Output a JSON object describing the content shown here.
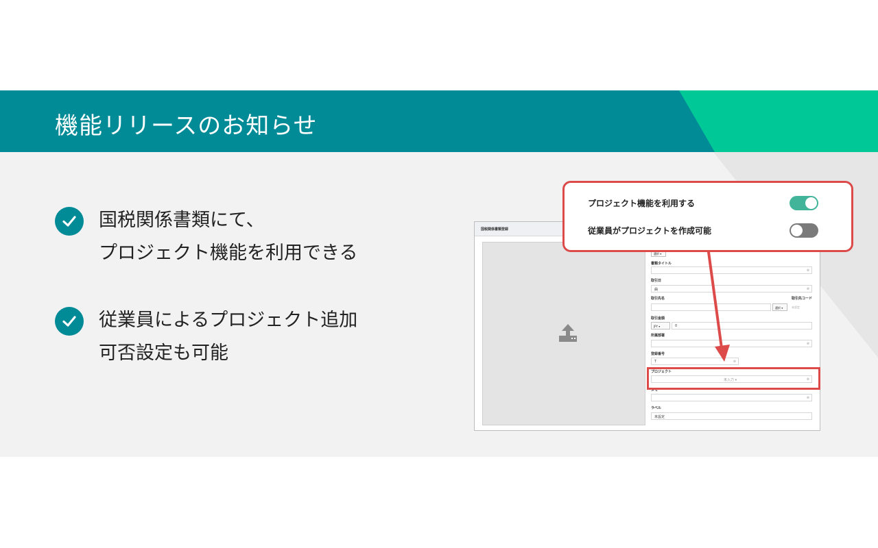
{
  "banner": {
    "title": "機能リリースのお知らせ"
  },
  "bullets": [
    {
      "line1": "国税関係書類にて、",
      "line2": "プロジェクト機能を利用できる"
    },
    {
      "line1": "従業員によるプロジェクト追加",
      "line2": "可否設定も可能"
    }
  ],
  "mock": {
    "header": "国税関係書類登録",
    "fields": {
      "doc_title_label": "書類タイトル",
      "date_label": "取引日",
      "date_value": "曲",
      "partner_label": "取引先名",
      "partner_code_label": "取引先コード",
      "partner_select": "選択 ▾",
      "partner_code_placeholder": "未設定",
      "amount_label": "取引金額",
      "currency": "JPY ▾",
      "amount_value": "0",
      "department_label": "所属部署",
      "reg_number_label": "登録番号",
      "reg_number_value": "T",
      "project_label": "プロジェクト",
      "project_value": "未入力 ▾",
      "memo_label": "メモ",
      "label_label": "ラベル",
      "label_value": "未設定",
      "top_chip": "選択 ▾"
    }
  },
  "callout": {
    "toggles": [
      {
        "label": "プロジェクト機能を利用する",
        "state": "on"
      },
      {
        "label": "従業員がプロジェクトを作成可能",
        "state": "off"
      }
    ]
  },
  "colors": {
    "teal": "#008b96",
    "green": "#00c896",
    "red": "#dc4a4a",
    "toggle_on": "#42b49a"
  }
}
